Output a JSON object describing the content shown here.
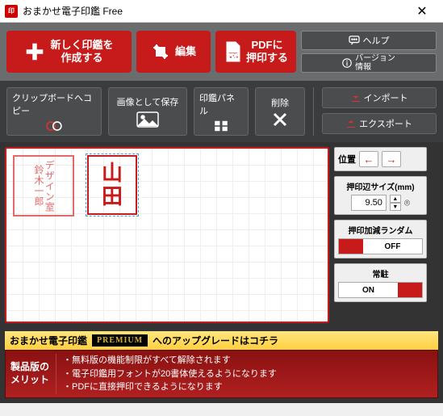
{
  "window": {
    "title": "おまかせ電子印鑑 Free",
    "icon_text": "印"
  },
  "toolbar": {
    "create": "新しく印鑑を\n作成する",
    "edit": "編集",
    "pdf": "PDFに\n押印する",
    "help": "ヘルプ",
    "version": "バージョン\n情報"
  },
  "midbar": {
    "clipboard": "クリップボードへコピー",
    "save_image": "画像として保存",
    "stamp_panel": "印鑑パネル",
    "delete": "削除",
    "import": "インポート",
    "export": "エクスポート"
  },
  "stamps": {
    "suzuki": "デザイン室\n鈴木一郎",
    "yamada_line1": "山",
    "yamada_line2": "田"
  },
  "side": {
    "position_label": "位置",
    "size_label": "押印辺サイズ(mm)",
    "size_value": "9.50",
    "stepper_icon": "⌾",
    "random_label": "押印加減ランダム",
    "random_state": "OFF",
    "resident_label": "常駐",
    "resident_state": "ON"
  },
  "footer": {
    "upgrade_prefix": "おまかせ電子印鑑",
    "premium": "PREMIUM",
    "upgrade_suffix": "へのアップグレードはコチラ",
    "merit_label1": "製品版の",
    "merit_label2": "メリット",
    "merits": [
      "無料版の機能制限がすべて解除されます",
      "電子印鑑用フォントが20書体使えるようになります",
      "PDFに直接押印できるようになります"
    ]
  }
}
